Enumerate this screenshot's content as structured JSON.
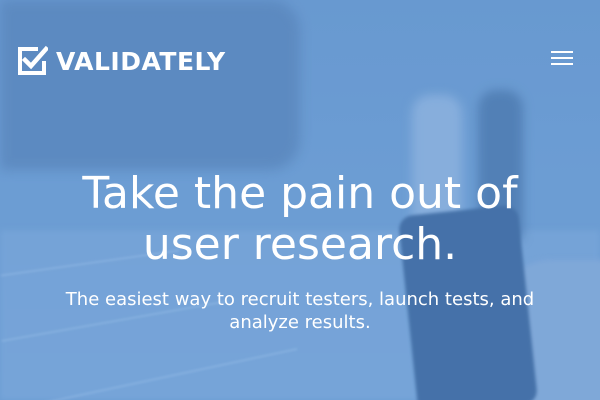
{
  "brand": {
    "name": "VALIDATELY",
    "icon": "checkbox-check-icon"
  },
  "nav": {
    "menu_icon": "hamburger-menu-icon"
  },
  "hero": {
    "headline_line1": "Take the pain out of",
    "headline_line2": "user research.",
    "subhead_line1": "The easiest way to recruit testers, launch tests, and",
    "subhead_line2": "analyze results."
  },
  "colors": {
    "background_tint": "#6f9fd3",
    "text": "#ffffff"
  }
}
